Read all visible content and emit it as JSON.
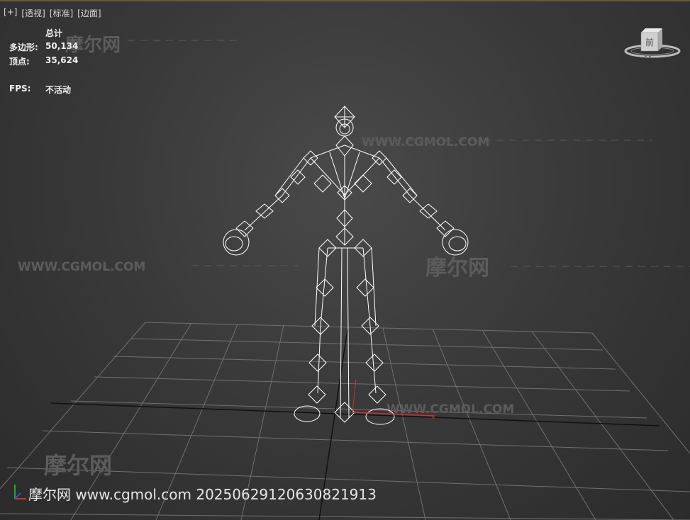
{
  "viewport": {
    "menu": [
      "[+]",
      "[透视]",
      "[标准]",
      "[边面]"
    ]
  },
  "stats": {
    "header": "总计",
    "polygons_label": "多边形:",
    "polygons_value": "50,134",
    "vertices_label": "顶点:",
    "vertices_value": "35,624",
    "fps_label": "FPS:",
    "fps_value": "不活动"
  },
  "watermarks": {
    "url": "WWW.CGMOL.COM",
    "logo": "摩尔网"
  },
  "viewcube": {
    "label": "前"
  },
  "footer": {
    "text": "摩尔网 www.cgmol.com 20250629120630821913"
  },
  "colors": {
    "background": "#3a3a3a",
    "grid": "#6e6e6e",
    "wireframe": "#ffffff",
    "x_axis": "#d03030",
    "y_axis": "#30a030",
    "accent": "#6b5a2a"
  }
}
